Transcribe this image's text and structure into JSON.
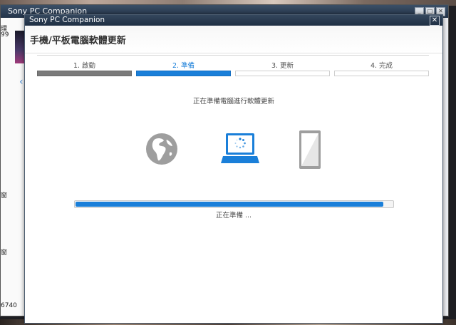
{
  "background_window": {
    "title": "Sony PC Companion",
    "left_text_1": "理",
    "left_text_2": "99",
    "left_text_3": "窗",
    "left_text_4": "窗",
    "left_text_5": "6740"
  },
  "dialog": {
    "title": "Sony PC Companion",
    "heading": "手機/平板電腦軟體更新",
    "close_glyph": "✕"
  },
  "steps": [
    {
      "label": "1. 啟動",
      "state": "done"
    },
    {
      "label": "2. 準備",
      "state": "active"
    },
    {
      "label": "3. 更新",
      "state": "pending"
    },
    {
      "label": "4. 完成",
      "state": "pending"
    }
  ],
  "status_text": "正在準備電腦進行軟體更新",
  "icons": {
    "source": "globe-icon",
    "computer": "laptop-loading-icon",
    "device": "phone-icon"
  },
  "progress": {
    "fraction": 0.97,
    "caption": "正在準備 ..."
  },
  "colors": {
    "accent": "#1a7fd9",
    "done": "#7a7a7a",
    "icon_gray": "#9e9e9e"
  }
}
